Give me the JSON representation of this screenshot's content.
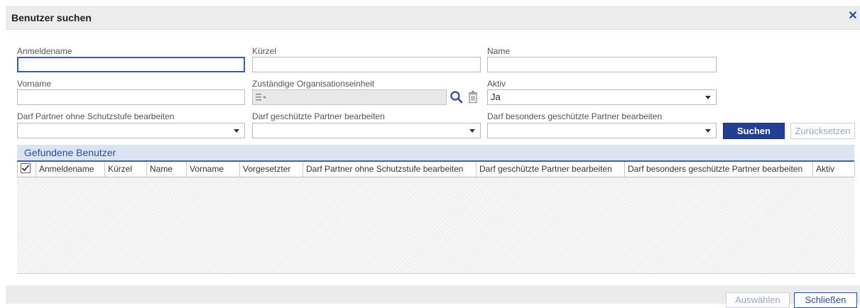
{
  "dialog": {
    "title": "Benutzer suchen"
  },
  "form": {
    "anmeldename": {
      "label": "Anmeldename",
      "value": ""
    },
    "kuerzel": {
      "label": "Kürzel",
      "value": ""
    },
    "name": {
      "label": "Name",
      "value": ""
    },
    "vorname": {
      "label": "Vorname",
      "value": ""
    },
    "org_einheit": {
      "label": "Zuständige Organisationseinheit",
      "value": ""
    },
    "aktiv": {
      "label": "Aktiv",
      "value": "Ja"
    },
    "partner_ohne_schutz": {
      "label": "Darf Partner ohne Schutzstufe bearbeiten",
      "value": ""
    },
    "geschuetzte_partner": {
      "label": "Darf geschützte Partner bearbeiten",
      "value": ""
    },
    "besonders_geschuetzte": {
      "label": "Darf besonders geschützte Partner bearbeiten",
      "value": ""
    },
    "search_button": "Suchen",
    "reset_button": "Zurücksetzen"
  },
  "results": {
    "title": "Gefundene Benutzer",
    "select_all_checked": true,
    "columns": [
      "Anmeldename",
      "Kürzel",
      "Name",
      "Vorname",
      "Vorgesetzter",
      "Darf Partner ohne Schutzstufe bearbeiten",
      "Darf geschützte Partner bearbeiten",
      "Darf besonders geschützte Partner bearbeiten",
      "Aktiv"
    ],
    "rows": []
  },
  "footer": {
    "select_button": "Auswählen",
    "close_button": "Schließen"
  },
  "colors": {
    "accent": "#233f93",
    "header_bg": "#dbe3f2",
    "link": "#2a48a0"
  },
  "icons": {
    "close": "close-icon",
    "list": "list-select-icon",
    "search": "search-icon",
    "trash": "trash-icon",
    "dropdown": "chevron-down-icon",
    "checkbox": "checkbox-checked-icon"
  }
}
